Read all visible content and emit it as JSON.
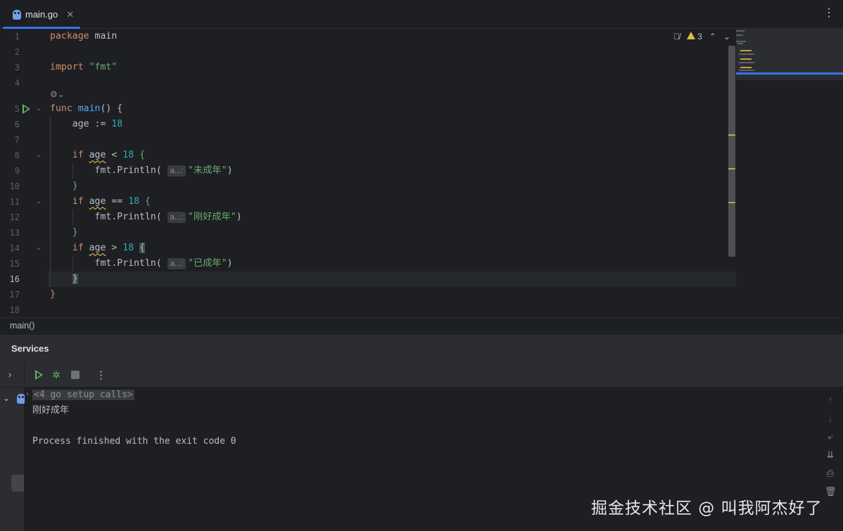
{
  "tab": {
    "label": "main.go",
    "close": "✕"
  },
  "editor": {
    "inspection": {
      "warning_count": "3"
    },
    "line_numbers": [
      "1",
      "2",
      "3",
      "4",
      "5",
      "6",
      "7",
      "8",
      "9",
      "10",
      "11",
      "12",
      "13",
      "14",
      "15",
      "16",
      "17",
      "18"
    ],
    "code": {
      "l1_kw": "package",
      "l1_name": "main",
      "l3_kw": "import",
      "l3_str": "\"fmt\"",
      "l5_kw": "func",
      "l5_fn": "main",
      "l5_rest": "() {",
      "l6_var": "age",
      "l6_op": " := ",
      "l6_num": "18",
      "l8_kw": "if",
      "l8_var": "age",
      "l8_op": " < ",
      "l8_num": "18",
      "println": "fmt.Println(",
      "hint": "a...:",
      "l9_str": "\"未成年\"",
      "l11_kw": "if",
      "l11_var": "age",
      "l11_op": " == ",
      "l11_num": "18",
      "l12_str": "\"刚好成年\"",
      "l14_kw": "if",
      "l14_var": "age",
      "l14_op": " > ",
      "l14_num": "18",
      "l15_str": "\"已成年\"",
      "close_paren": ")",
      "open_brace": "{",
      "close_brace": "}"
    }
  },
  "breadcrumb": "main()",
  "services": {
    "title": "Services",
    "console": {
      "setup_calls": "<4 go setup calls>",
      "output": "刚好成年",
      "exit_message": "Process finished with the exit code 0"
    }
  },
  "watermark": "掘金技术社区 @ 叫我阿杰好了",
  "colors": {
    "accent": "#3574f0",
    "run_green": "#5fb865",
    "warning": "#e0b94a",
    "keyword": "#cf8e6d",
    "string": "#6aab73",
    "number": "#2aacb8",
    "function": "#56a8f5"
  },
  "icons": [
    "gopher-icon",
    "more-vertical-icon",
    "reader-mode-icon",
    "warning-icon",
    "chevron-up-icon",
    "chevron-down-icon",
    "run-icon",
    "fold-icon",
    "generate-icon",
    "expand-icon",
    "debug-icon",
    "stop-icon",
    "scroll-up-icon",
    "scroll-down-icon",
    "soft-wrap-icon",
    "scroll-to-end-icon",
    "print-icon",
    "trash-icon"
  ]
}
